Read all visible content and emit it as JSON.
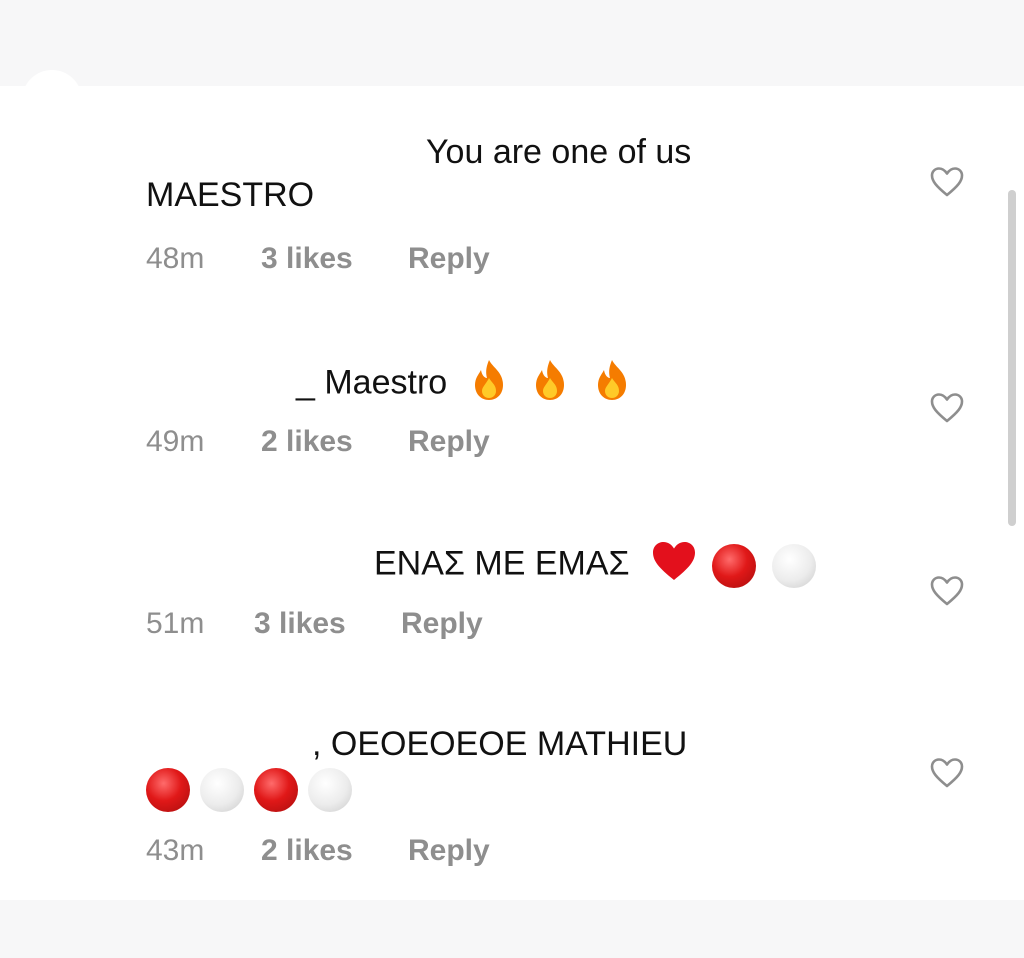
{
  "comments": [
    {
      "line1": "You are one of us",
      "line2": "MAESTRO",
      "time": "48m",
      "likes": "3 likes",
      "reply": "Reply"
    },
    {
      "line1": "_ Maestro",
      "emojis": [
        "fire",
        "fire",
        "fire"
      ],
      "time": "49m",
      "likes": "2 likes",
      "reply": "Reply"
    },
    {
      "line1": "ΕΝΑΣ ΜΕ ΕΜΑΣ",
      "emojis": [
        "red-heart",
        "red-circle",
        "white-circle"
      ],
      "time": "51m",
      "likes": "3 likes",
      "reply": "Reply"
    },
    {
      "line1": ", ΟΕΟΕΟΕΟΕ MATHIEU",
      "emojis": [
        "red-circle",
        "white-circle",
        "red-circle",
        "white-circle"
      ],
      "time": "43m",
      "likes": "2 likes",
      "reply": "Reply"
    }
  ],
  "colors": {
    "text": "#111111",
    "meta": "#8e8e8e",
    "background": "#ffffff",
    "band": "#f7f7f8"
  },
  "icons": [
    "heart-outline-icon",
    "fire-emoji",
    "red-heart-emoji",
    "red-circle-emoji",
    "white-circle-emoji"
  ]
}
